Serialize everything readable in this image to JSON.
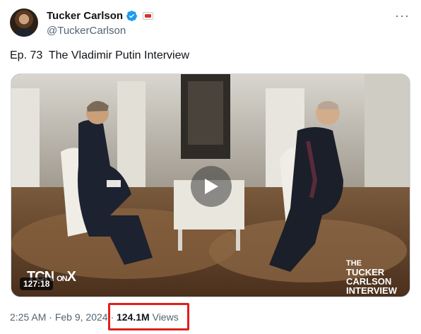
{
  "author": {
    "name": "Tucker Carlson",
    "handle": "@TuckerCarlson"
  },
  "tweet": {
    "text": "Ep. 73  The Vladimir Putin Interview"
  },
  "media": {
    "duration": "127:18",
    "logo_left": "TCN",
    "logo_left_on": "ON",
    "logo_left_x": "X",
    "logo_right_line1": "THE",
    "logo_right_line2": "TUCKER",
    "logo_right_line3": "CARLSON",
    "logo_right_line4": "INTERVIEW"
  },
  "meta": {
    "time": "2:25 AM",
    "separator": " · ",
    "date": "Feb 9, 2024",
    "separator2": " · ",
    "views_count": "124.1M",
    "views_label": " Views"
  },
  "colors": {
    "verified": "#1d9bf0",
    "highlight": "#e0201b",
    "secondary_text": "#536471"
  },
  "icons": {
    "verified": "verified-badge-icon",
    "affiliate": "affiliate-badge-icon",
    "more": "more-icon",
    "play": "play-icon"
  }
}
